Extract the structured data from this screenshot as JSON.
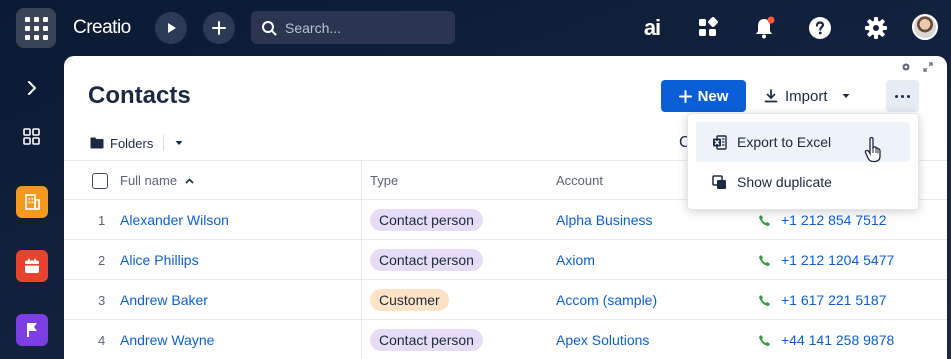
{
  "app": {
    "logo": "Creatio"
  },
  "search": {
    "placeholder": "Search..."
  },
  "topbar": {
    "ai_label": "ai"
  },
  "page": {
    "title": "Contacts"
  },
  "toolbar": {
    "new_label": "New",
    "import_label": "Import"
  },
  "filters": {
    "folders_label": "Folders",
    "clipped_label": "C"
  },
  "table": {
    "columns": {
      "full_name": "Full name",
      "type": "Type",
      "account": "Account"
    },
    "rows": [
      {
        "num": "1",
        "name": "Alexander Wilson",
        "type": "Contact person",
        "type_kind": "contact",
        "account": "Alpha Business",
        "phone": "+1 212 854 7512"
      },
      {
        "num": "2",
        "name": "Alice Phillips",
        "type": "Contact person",
        "type_kind": "contact",
        "account": "Axiom",
        "phone": "+1 212 1204 5477"
      },
      {
        "num": "3",
        "name": "Andrew Baker",
        "type": "Customer",
        "type_kind": "customer",
        "account": "Accom (sample)",
        "phone": "+1 617 221 5187"
      },
      {
        "num": "4",
        "name": "Andrew Wayne",
        "type": "Contact person",
        "type_kind": "contact",
        "account": "Apex Solutions",
        "phone": "+44 141 258 9878"
      }
    ]
  },
  "menu": {
    "export_excel": "Export to Excel",
    "show_duplicate": "Show duplicate"
  },
  "colors": {
    "accent": "#0b5fd6",
    "topbar_bg": "#0b1a33",
    "contact_tag": "#e6dcf8",
    "customer_tag": "#fde2c4",
    "phone_green": "#2e9e3e"
  }
}
